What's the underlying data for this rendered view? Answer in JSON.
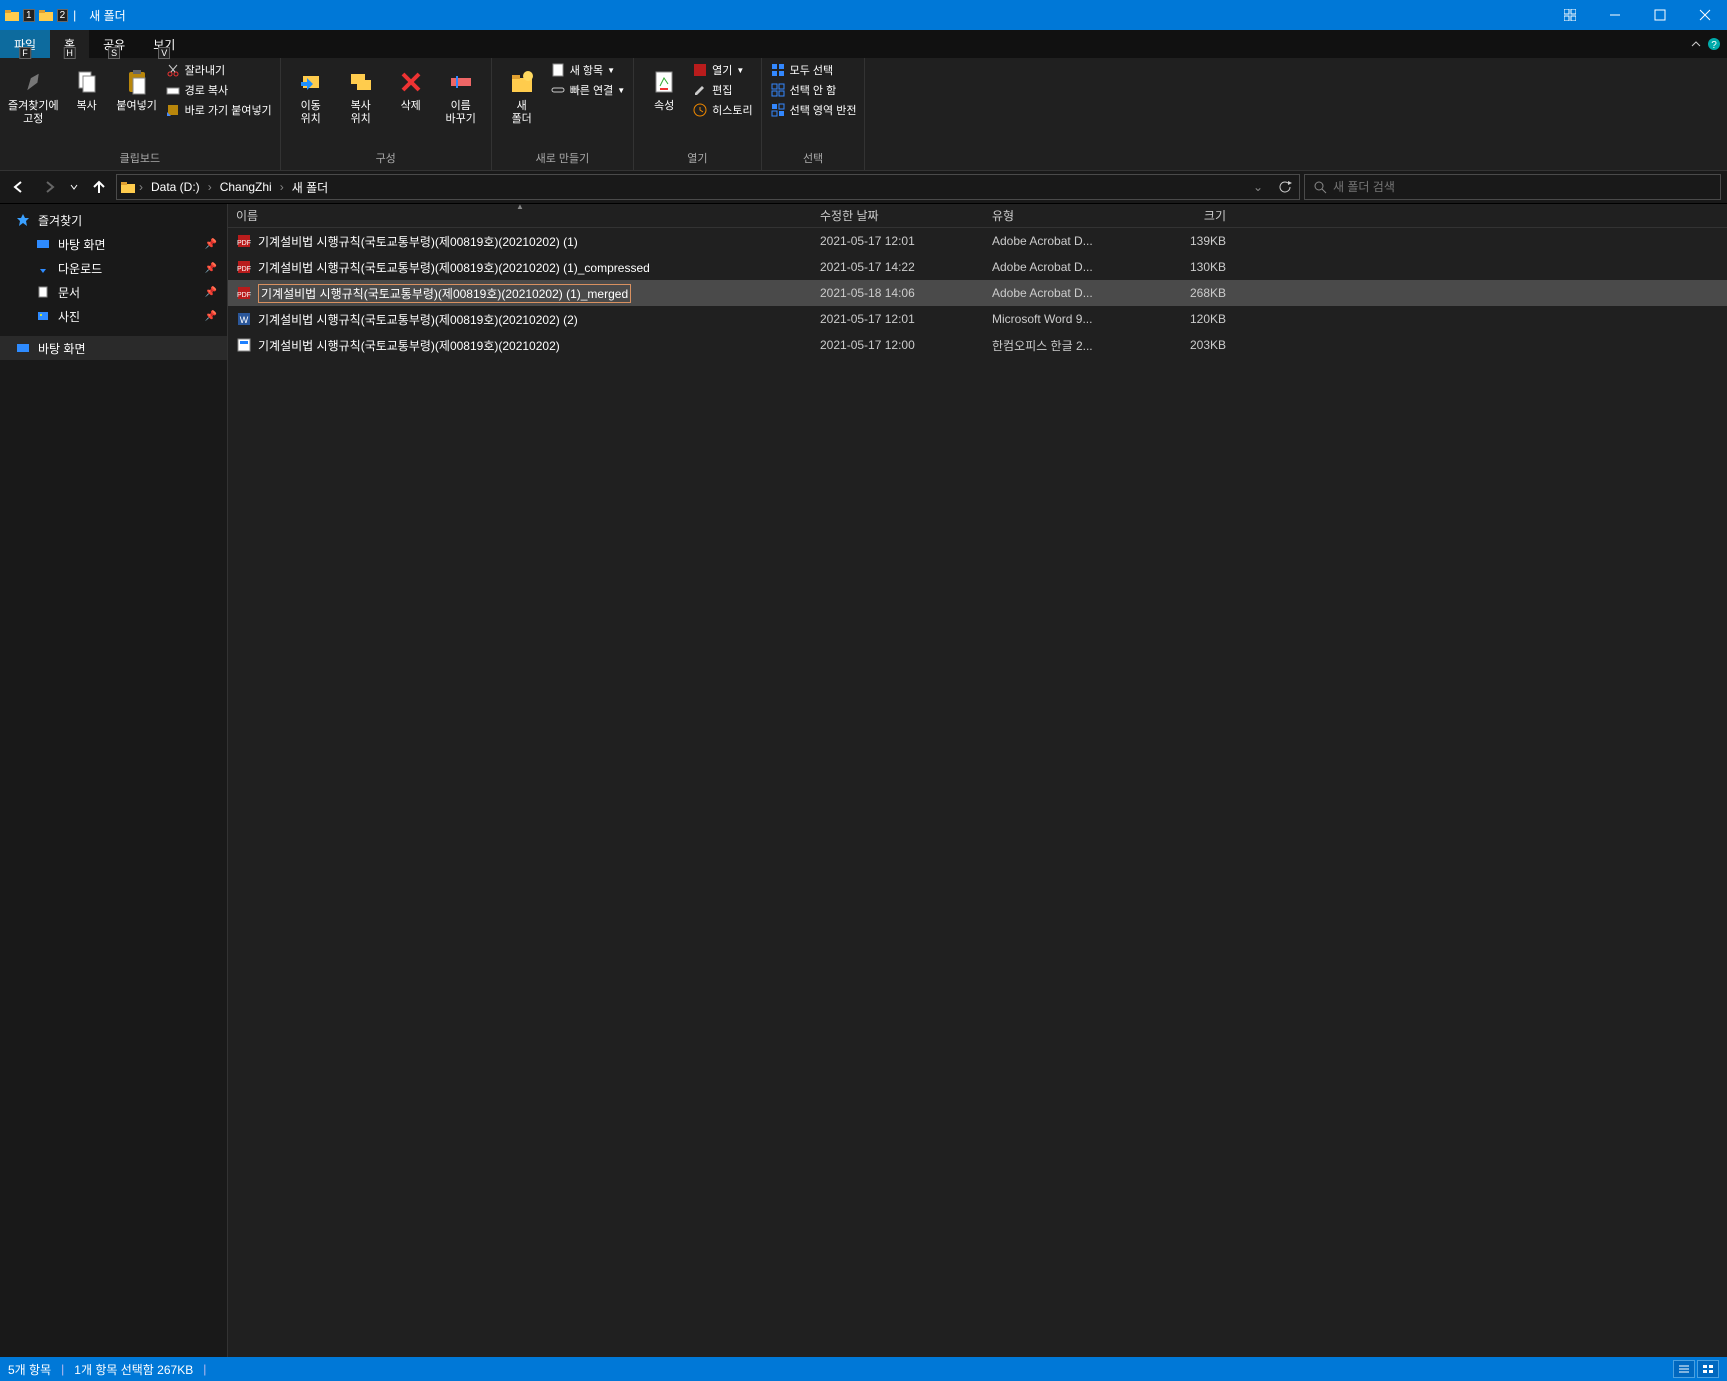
{
  "title": "새 폴더",
  "qat_badges": [
    "1",
    "2",
    "F"
  ],
  "tabs": {
    "file": "파일",
    "home": "홈",
    "share": "공유",
    "view": "보기",
    "hints": {
      "home": "H",
      "share": "S",
      "view": "V"
    }
  },
  "ribbon": {
    "clipboard": {
      "label": "클립보드",
      "pin": "즐겨찾기에\n고정",
      "copy": "복사",
      "paste": "붙여넣기",
      "cut": "잘라내기",
      "copypath": "경로 복사",
      "pasteshortcut": "바로 가기 붙여넣기"
    },
    "organize": {
      "label": "구성",
      "move": "이동\n위치",
      "copyto": "복사\n위치",
      "delete": "삭제",
      "rename": "이름\n바꾸기"
    },
    "new": {
      "label": "새로 만들기",
      "folder": "새\n폴더",
      "newitem": "새 항목",
      "easyaccess": "빠른 연결"
    },
    "open": {
      "label": "열기",
      "properties": "속성",
      "open": "열기",
      "edit": "편집",
      "history": "히스토리"
    },
    "select": {
      "label": "선택",
      "selectall": "모두 선택",
      "selectnone": "선택 안 함",
      "invert": "선택 영역 반전"
    }
  },
  "breadcrumb": [
    "Data (D:)",
    "ChangZhi",
    "새 폴더"
  ],
  "search_placeholder": "새 폴더 검색",
  "sidebar": {
    "quick": "즐겨찾기",
    "desktop": "바탕 화면",
    "downloads": "다운로드",
    "documents": "문서",
    "pictures": "사진",
    "desktop2": "바탕 화면"
  },
  "columns": {
    "name": "이름",
    "date": "수정한 날짜",
    "type": "유형",
    "size": "크기"
  },
  "files": [
    {
      "icon": "pdf",
      "name": "기계설비법 시행규칙(국토교통부령)(제00819호)(20210202) (1)",
      "date": "2021-05-17 12:01",
      "type": "Adobe Acrobat D...",
      "size": "139KB",
      "selected": false
    },
    {
      "icon": "pdf",
      "name": "기계설비법 시행규칙(국토교통부령)(제00819호)(20210202) (1)_compressed",
      "date": "2021-05-17 14:22",
      "type": "Adobe Acrobat D...",
      "size": "130KB",
      "selected": false
    },
    {
      "icon": "pdf",
      "name": "기계설비법 시행규칙(국토교통부령)(제00819호)(20210202) (1)_merged",
      "date": "2021-05-18 14:06",
      "type": "Adobe Acrobat D...",
      "size": "268KB",
      "selected": true
    },
    {
      "icon": "word",
      "name": "기계설비법 시행규칙(국토교통부령)(제00819호)(20210202) (2)",
      "date": "2021-05-17 12:01",
      "type": "Microsoft Word 9...",
      "size": "120KB",
      "selected": false
    },
    {
      "icon": "hwp",
      "name": "기계설비법 시행규칙(국토교통부령)(제00819호)(20210202)",
      "date": "2021-05-17 12:00",
      "type": "한컴오피스 한글 2...",
      "size": "203KB",
      "selected": false
    }
  ],
  "status": {
    "count": "5개 항목",
    "sel": "1개 항목 선택함 267KB"
  }
}
